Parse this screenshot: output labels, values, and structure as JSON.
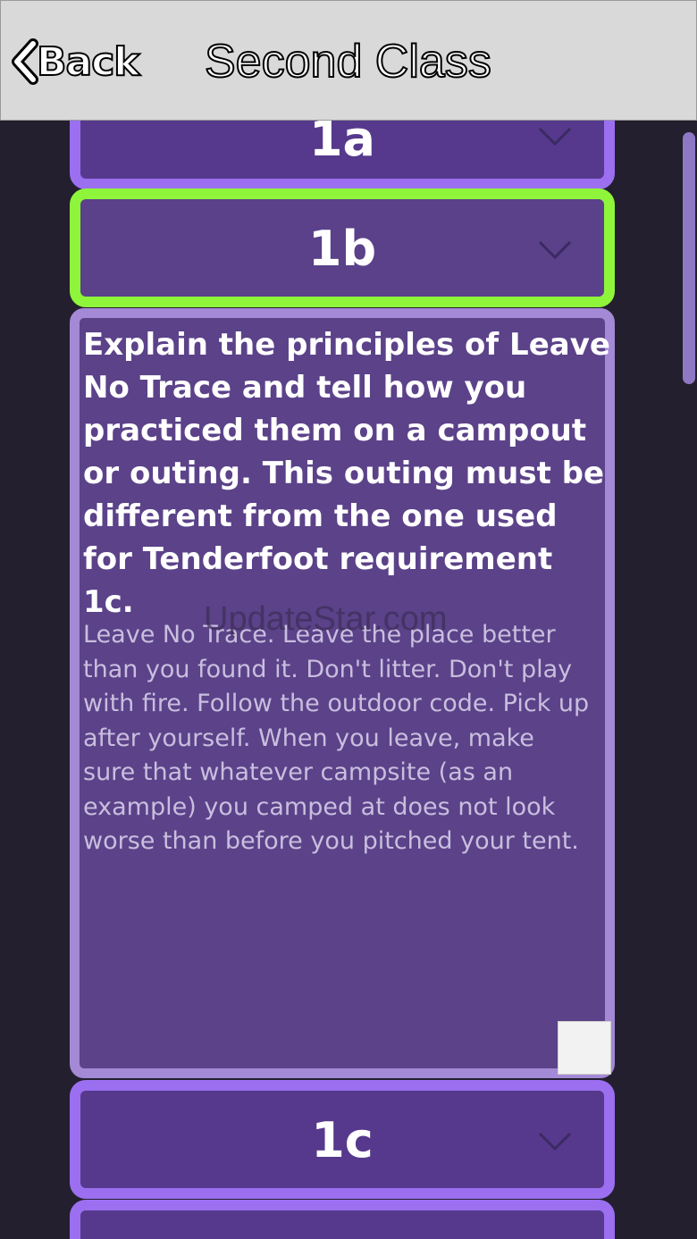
{
  "header": {
    "back_label": "Back",
    "title": "Second Class"
  },
  "requirements": [
    {
      "label": "1a",
      "expanded": false
    },
    {
      "label": "1b",
      "expanded": true,
      "selected": true
    },
    {
      "label": "1c",
      "expanded": false
    }
  ],
  "detail": {
    "heading": "Explain the principles of Leave No Trace and tell how you practiced them on a campout or outing. This outing must be different from the one used for Tenderfoot requirement 1c.",
    "body": "Leave No Trace. Leave the place better than you found it. Don't litter. Don't play with fire. Follow the outdoor code. Pick up after yourself. When you leave, make sure that whatever campsite (as an example) you camped at does not look worse than before you pitched your tent."
  },
  "watermark": "UpdateStar.com",
  "colors": {
    "background": "#231f2e",
    "card": "#56398c",
    "card_border": "#9b6ff0",
    "selected_border": "#8ef53b",
    "header": "#d9d9d9"
  }
}
